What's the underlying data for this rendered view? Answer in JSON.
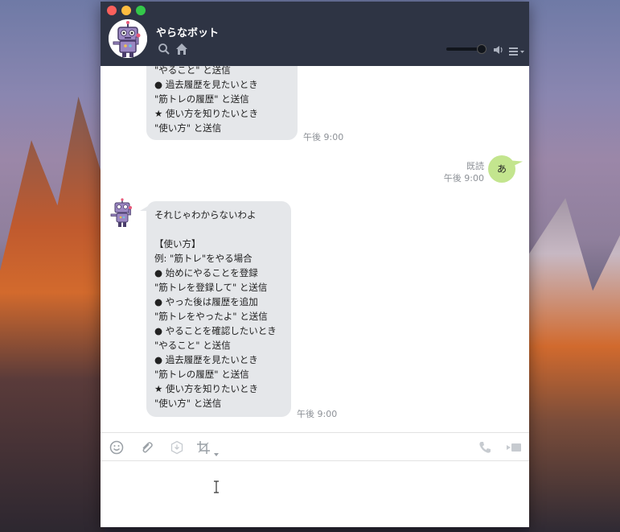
{
  "window": {
    "chat_name": "やらなボット",
    "icons": [
      "search-icon",
      "home-icon",
      "speaker-icon",
      "menu-icon"
    ]
  },
  "messages": [
    {
      "from": "bot",
      "text": "\"やること\" と送信\n● 過去履歴を見たいとき\n\"筋トレの履歴\" と送信\n★ 使い方を知りたいとき\n\"使い方\" と送信",
      "time": "午後 9:00"
    },
    {
      "from": "me",
      "text": "あ",
      "read": "既読",
      "time": "午後 9:00"
    },
    {
      "from": "bot",
      "text": "それじゃわからないわよ\n\n【使い方】\n例: \"筋トレ\"をやる場合\n● 始めにやることを登録\n\"筋トレを登録して\" と送信\n● やった後は履歴を追加\n\"筋トレをやったよ\" と送信\n● やることを確認したいとき\n\"やること\" と送信\n● 過去履歴を見たいとき\n\"筋トレの履歴\" と送信\n★ 使い方を知りたいとき\n\"使い方\" と送信",
      "time": "午後 9:00"
    }
  ],
  "toolbar": {
    "icons": [
      "emoji-icon",
      "attach-icon",
      "download-icon",
      "crop-icon",
      "phone-icon",
      "video-icon"
    ]
  },
  "colors": {
    "titlebar": "#2e3444",
    "bot_bubble": "#e5e7ea",
    "my_bubble": "#c3e58e"
  }
}
